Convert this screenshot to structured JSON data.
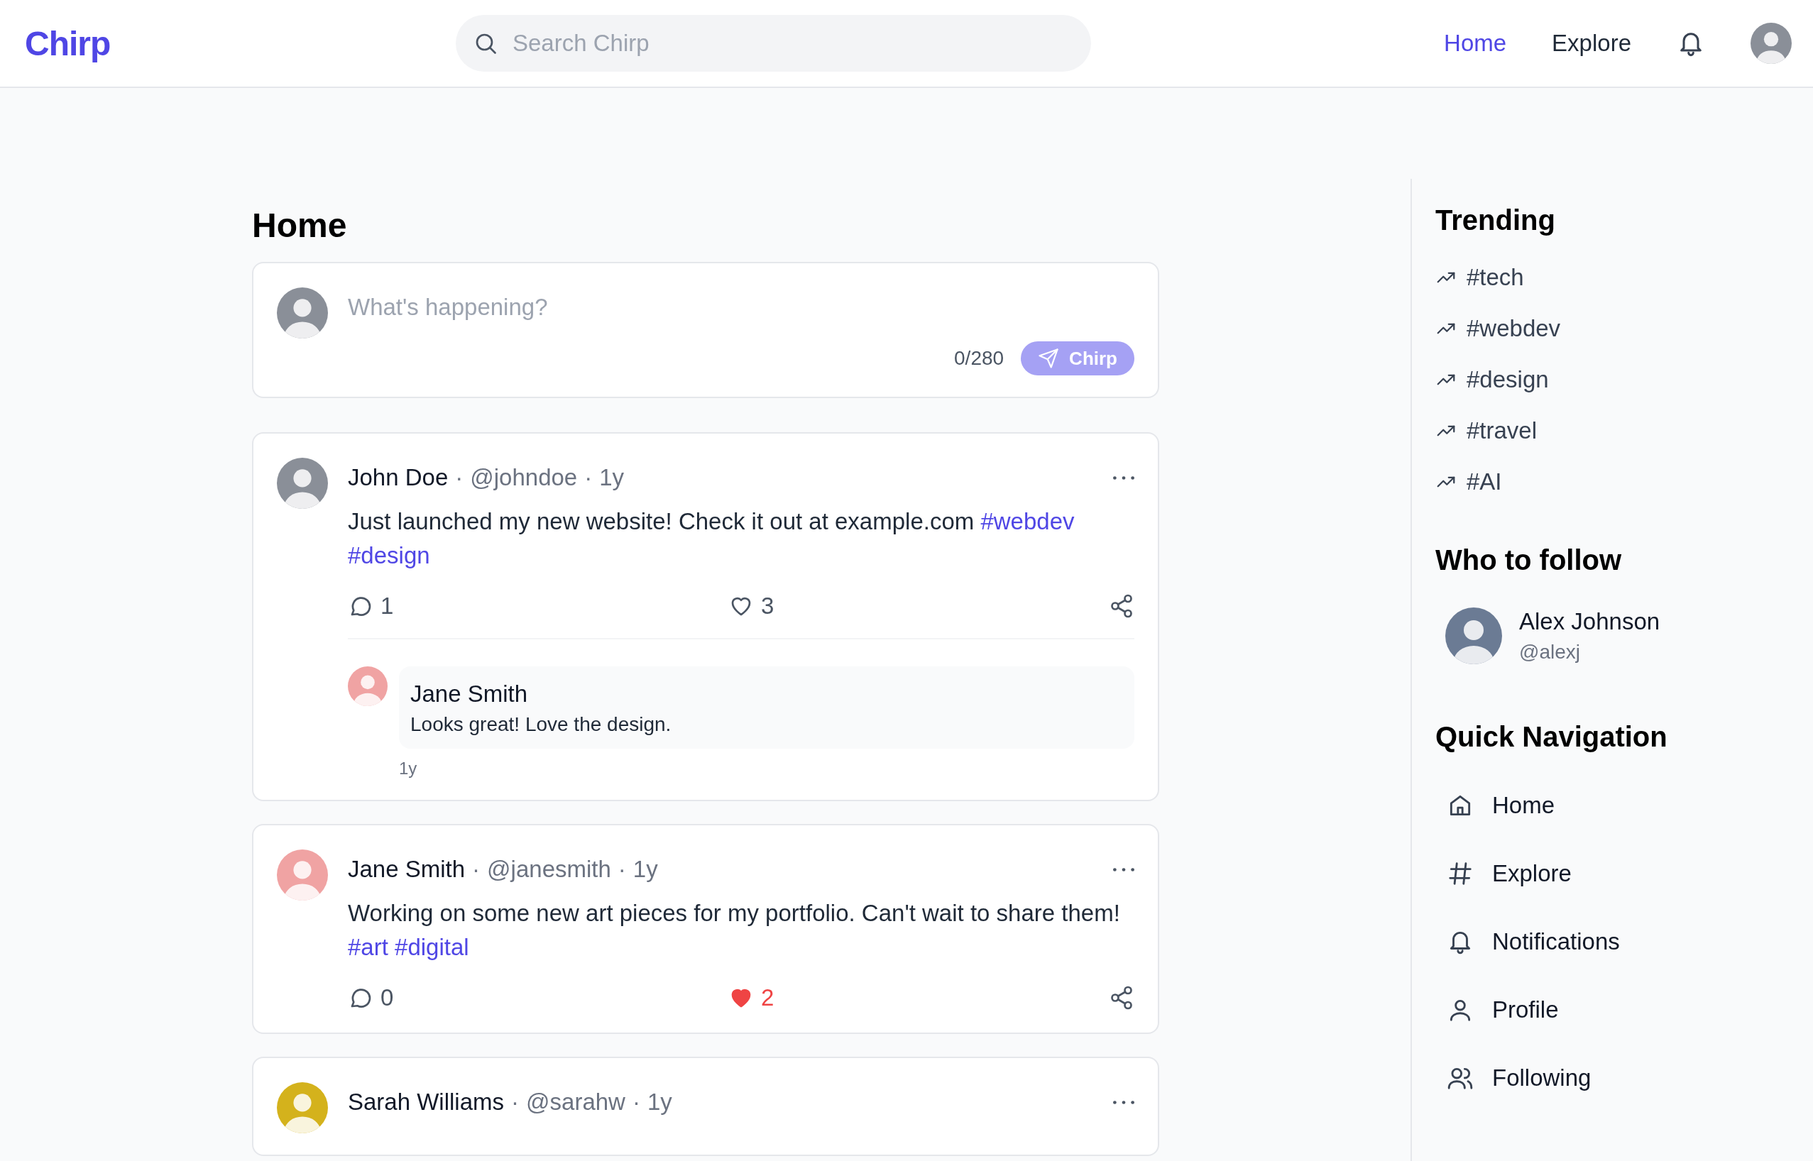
{
  "header": {
    "logo": "Chirp",
    "search": {
      "placeholder": "Search Chirp"
    },
    "nav": [
      {
        "label": "Home",
        "selected": true
      },
      {
        "label": "Explore",
        "selected": false
      }
    ]
  },
  "feed": {
    "title": "Home",
    "composer": {
      "placeholder": "What's happening?",
      "counter": "0/280",
      "button": {
        "label": "Chirp",
        "disabled": true
      }
    },
    "posts": [
      {
        "name": "John Doe",
        "separator": "·",
        "handle": "@johndoe",
        "time": "1y",
        "text": "Just launched my new website! Check it out at example.com",
        "tags": [
          "#webdev",
          "#design"
        ],
        "comments": "1",
        "likes": "3",
        "liked": false,
        "replies": [
          {
            "name": "Jane Smith",
            "text": "Looks great! Love the design.",
            "time": "1y"
          }
        ]
      },
      {
        "name": "Jane Smith",
        "separator": "·",
        "handle": "@janesmith",
        "time": "1y",
        "text": "Working on some new art pieces for my portfolio. Can't wait to share them!",
        "tags": [
          "#art",
          "#digital"
        ],
        "comments": "0",
        "likes": "2",
        "liked": true
      },
      {
        "name": "Sarah Williams",
        "separator": "·",
        "handle": "@sarahw",
        "time": "1y"
      }
    ]
  },
  "sidebar": {
    "trending": {
      "title": "Trending",
      "items": [
        "#tech",
        "#webdev",
        "#design",
        "#travel",
        "#AI"
      ]
    },
    "who_to_follow": {
      "title": "Who to follow",
      "users": [
        {
          "name": "Alex Johnson",
          "handle": "@alexj"
        }
      ]
    },
    "quick_navigation": {
      "title": "Quick Navigation",
      "items": [
        {
          "kind": "home",
          "label": "Home"
        },
        {
          "kind": "hashtag",
          "label": "Explore"
        },
        {
          "kind": "bell",
          "label": "Notifications"
        },
        {
          "kind": "person",
          "label": "Profile"
        },
        {
          "kind": "people",
          "label": "Following"
        }
      ]
    }
  }
}
